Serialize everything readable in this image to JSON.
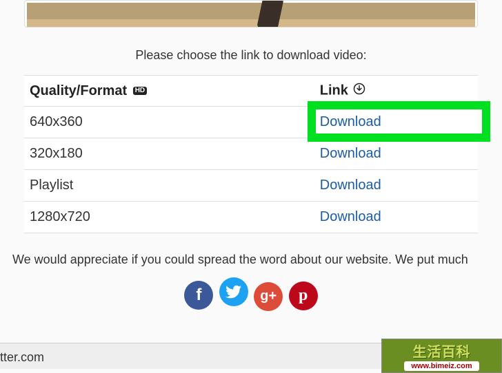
{
  "instruction": "Please choose the link to download video:",
  "table": {
    "header_quality": "Quality/Format",
    "hd_label": "HD",
    "header_link": "Link",
    "rows": [
      {
        "quality": "640x360",
        "link": "Download",
        "highlight": true
      },
      {
        "quality": "320x180",
        "link": "Download"
      },
      {
        "quality": "Playlist",
        "link": "Download"
      },
      {
        "quality": "1280x720",
        "link": "Download"
      }
    ]
  },
  "appreciate": "We would appreciate if you could spread the word about our website. We put much",
  "social": {
    "fb": "f",
    "tw": "",
    "gp": "g+",
    "pi": "p"
  },
  "footer_text": "tter.com",
  "watermark": {
    "cn": "生活百科",
    "url": "www.bimeiz.com"
  }
}
